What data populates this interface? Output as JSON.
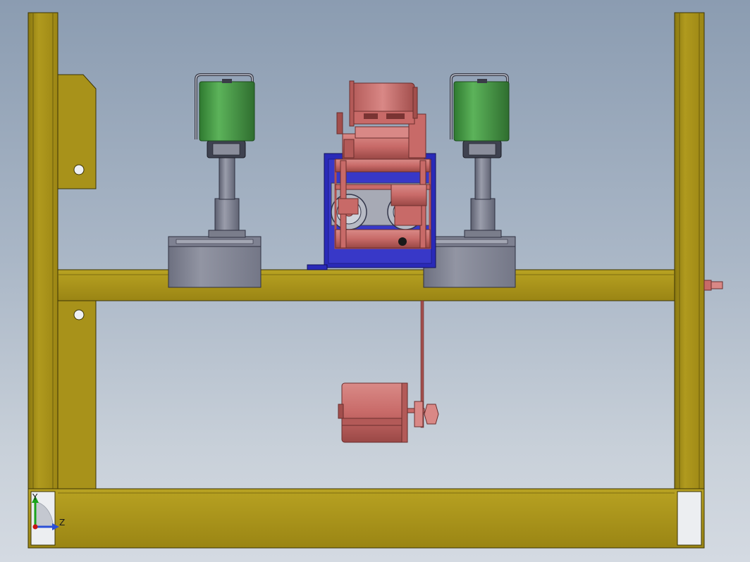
{
  "viewport": {
    "background_top": "#8b9cb1",
    "background_bottom": "#d4dae2"
  },
  "colors": {
    "frame": "#a8921a",
    "frame_shadow": "#7d6c10",
    "frame_edge": "#3b3405",
    "solenoid_coil": "#4ea84e",
    "solenoid_dark": "#2f6e2f",
    "motor_copper": "#c86a68",
    "motor_dark": "#8f3f3e",
    "plate_blue": "#2a2ab8",
    "steel_grey": "#888b98",
    "steel_dark": "#5d6070",
    "axis_y": "#1aa31a",
    "axis_z": "#2a4fd6",
    "axis_origin": "#c81414"
  },
  "triad": {
    "y_label": "Y",
    "z_label": "Z"
  },
  "parts": [
    {
      "name": "frame-left-post",
      "type": "frame"
    },
    {
      "name": "frame-right-post",
      "type": "frame"
    },
    {
      "name": "frame-top-crossbeam",
      "type": "frame"
    },
    {
      "name": "frame-bottom-beam",
      "type": "frame"
    },
    {
      "name": "solenoid-actuator-left",
      "type": "solenoid"
    },
    {
      "name": "solenoid-actuator-right",
      "type": "solenoid"
    },
    {
      "name": "gear-motor-assembly",
      "type": "motor"
    },
    {
      "name": "hanging-motor",
      "type": "motor"
    },
    {
      "name": "side-pin",
      "type": "fastener"
    }
  ]
}
